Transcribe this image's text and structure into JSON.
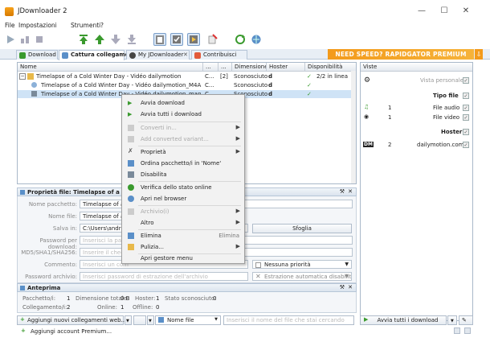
{
  "app": {
    "title": "JDownloader 2"
  },
  "menu": [
    "File",
    "Impostazioni",
    "Strumenti",
    "?"
  ],
  "tabs": [
    {
      "label": "Download"
    },
    {
      "label": "Cattura collegamenti"
    },
    {
      "label": "My JDownloader"
    },
    {
      "label": "Contribuisci"
    }
  ],
  "promo": {
    "text": "NEED SPEED? RAPIDGATOR PREMIUM"
  },
  "list": {
    "headers": [
      "Nome",
      "...",
      "...",
      "Dimensione",
      "Hoster",
      "Disponibilità"
    ],
    "rows": [
      {
        "name": "Timelapse of a Cold Winter Day - Vidéo dailymotion",
        "c1": "C...",
        "c2": "[2]",
        "size": "Sconosciuto",
        "hoster": "d",
        "avail": "2/2 in linea"
      },
      {
        "name": "Timelapse of a Cold Winter Day - Vidéo dailymotion_M4A Audio (...",
        "c1": "C...",
        "c2": "",
        "size": "Sconosciuto",
        "hoster": "d",
        "avail": ""
      },
      {
        "name": "Timelapse of a Cold Winter Day - Vidéo dailymotion_manifest.m4...",
        "c1": "C...",
        "c2": "",
        "size": "Sconosciuto",
        "hoster": "d",
        "avail": ""
      }
    ]
  },
  "side": {
    "header": "Viste",
    "personal_view": "Vista personale",
    "type_header": "Tipo file",
    "types": [
      {
        "count": "1",
        "label": "File audio"
      },
      {
        "count": "1",
        "label": "File video"
      }
    ],
    "hoster_header": "Hoster",
    "hosters": [
      {
        "count": "2",
        "label": "dailymotion.com"
      }
    ]
  },
  "props": {
    "title": "Proprietà file: Timelapse of a Cold Winter Day - Vidéo dailymotion",
    "labels": {
      "package": "Nome pacchetto:",
      "filename": "Nome file:",
      "save": "Salva in:",
      "password": "Password per download:",
      "hash": "MD5/SHA1/SHA256:",
      "comment": "Commento:",
      "archive_password": "Password archivio:"
    },
    "package_value": "Timelapse of a C",
    "filename_value": "Timelapse of a C",
    "save_value": "C:\\Users\\andreap",
    "password_placeholder": "Inserisci la passw",
    "hash_placeholder": "Inserire il checks",
    "comment_placeholder": "Inserisci un com",
    "archive_password_placeholder": "Inserisci password di estrazione dell'archivio",
    "browse_button": "Sfoglia",
    "priority": "Nessuna priorità",
    "auto_extract": "Estrazione automatica disabilitata"
  },
  "preview": {
    "title": "Anteprima",
    "packages_label": "Pacchetto/i:",
    "packages": "1",
    "total_label": "Dimensione totale:",
    "total": "0 B",
    "hoster_label": "Hoster:",
    "hoster": "1",
    "unknown_label": "Stato sconosciuto:",
    "unknown": "0",
    "links_label": "Collegamento/i:",
    "links": "2",
    "online_label": "Online:",
    "online": "1",
    "offline_label": "Offline:",
    "offline": "0"
  },
  "bottom": {
    "add_links": "Aggiungi nuovi collegamenti web...",
    "filter_field": "Nome file",
    "search_placeholder": "Inserisci il nome del file che stai cercando",
    "start_all": "Avvia tutti i download"
  },
  "status": {
    "add_premium": "Aggiungi account Premium..."
  },
  "context_menu": {
    "items": [
      {
        "label": "Avvia download",
        "icon": "play-icon"
      },
      {
        "label": "Avvia tutti i download",
        "icon": "play-all-icon"
      },
      {
        "label": "Converti in...",
        "icon": "convert-icon",
        "disabled": true,
        "submenu": true
      },
      {
        "label": "Add converted variant...",
        "icon": "add-variant-icon",
        "disabled": true,
        "submenu": true
      },
      {
        "label": "Proprietà",
        "icon": "properties-icon",
        "submenu": true
      },
      {
        "label": "Ordina pacchetto/i in 'Nome'",
        "icon": "sort-icon"
      },
      {
        "label": "Disabilita",
        "icon": "disable-icon"
      },
      {
        "label": "Verifica dello stato online",
        "icon": "online-check-icon"
      },
      {
        "label": "Apri nel browser",
        "icon": "browser-icon"
      },
      {
        "label": "Archivio(i)",
        "icon": "archive-icon",
        "disabled": true,
        "submenu": true
      },
      {
        "label": "Altro",
        "icon": "more-icon",
        "submenu": true
      },
      {
        "label": "Elimina",
        "icon": "delete-icon",
        "shortcut": "Elimina"
      },
      {
        "label": "Pulizia...",
        "icon": "cleanup-icon",
        "submenu": true
      },
      {
        "label": "Apri gestore menu",
        "icon": "menu-manager-icon"
      }
    ]
  },
  "colors": {
    "accent": "#f39a1b",
    "selection": "#cfe3f6",
    "toolbar_green": "#3a9a2e"
  }
}
